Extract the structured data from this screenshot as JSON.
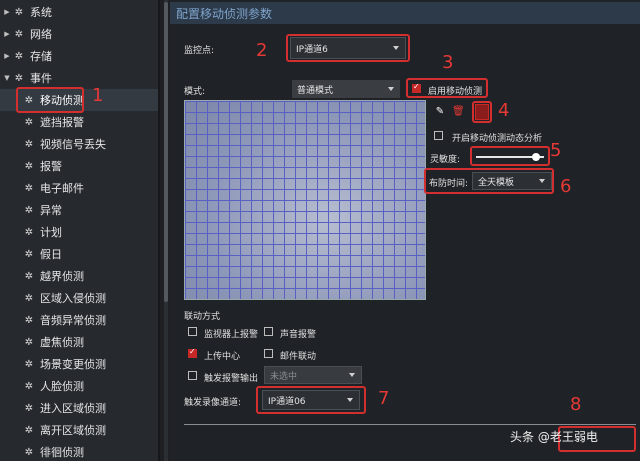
{
  "sidebar": {
    "top_items": [
      {
        "label": "系统"
      },
      {
        "label": "网络"
      },
      {
        "label": "存储"
      },
      {
        "label": "事件"
      }
    ],
    "sub_items": [
      {
        "label": "移动侦测"
      },
      {
        "label": "遮挡报警"
      },
      {
        "label": "视频信号丢失"
      },
      {
        "label": "报警"
      },
      {
        "label": "电子邮件"
      },
      {
        "label": "异常"
      },
      {
        "label": "计划"
      },
      {
        "label": "假日"
      },
      {
        "label": "越界侦测"
      },
      {
        "label": "区域入侵侦测"
      },
      {
        "label": "音频异常侦测"
      },
      {
        "label": "虚焦侦测"
      },
      {
        "label": "场景变更侦测"
      },
      {
        "label": "人脸侦测"
      },
      {
        "label": "进入区域侦测"
      },
      {
        "label": "离开区域侦测"
      },
      {
        "label": "徘徊侦测"
      }
    ]
  },
  "main": {
    "title": "配置移动侦测参数",
    "monitor_label": "监控点:",
    "monitor_value": "IP通道6",
    "mode_label": "模式:",
    "mode_value": "普通模式",
    "enable_motion_label": "启用移动侦测",
    "dynamic_analysis_label": "开启移动侦测动态分析",
    "sensitivity_label": "灵敏度:",
    "sensitivity_level": 0.88,
    "schedule_label": "布防时间:",
    "schedule_value": "全天模板",
    "linkage_title": "联动方式",
    "linkage": {
      "monitor_alarm": "监视器上报警",
      "sound_alarm": "声音报警",
      "upload_center": "上传中心",
      "email_linkage": "邮件联动",
      "trigger_output": "触发报警输出",
      "trigger_output_value": "未选中"
    },
    "trigger_channel_label": "触发录像通道:",
    "trigger_channel_value": "IP通道06"
  },
  "annotations": [
    "1",
    "2",
    "3",
    "4",
    "5",
    "6",
    "7",
    "8"
  ],
  "watermark": "头条 @老王弱电",
  "colors": {
    "accent_red": "#d32f2f",
    "title_blue": "#7fa4cc",
    "grid_line": "#5a5fc4"
  }
}
